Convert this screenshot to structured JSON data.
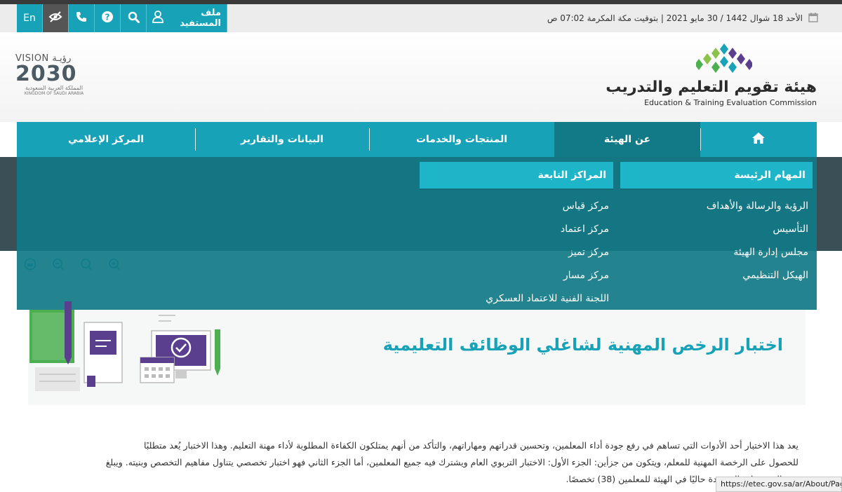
{
  "utility_bar": {
    "lang_label": "En",
    "beneficiary_label": "ملف المستفيد",
    "icons": [
      "eye-slash-icon",
      "phone-icon",
      "help-icon",
      "search-icon",
      "user-icon"
    ]
  },
  "date_text": "الأحد 18 شوال 1442 / 30 مايو 2021 | بتوقيت مكة المكرمة 07:02 ص",
  "vision_logo": {
    "line1": "VISION رؤيـة",
    "line2": "2030",
    "line3": "المملكة العربية السعودية",
    "line4": "KINGDOM OF SAUDI ARABIA"
  },
  "org_logo": {
    "name_ar": "هيئة تقويم التعليم والتدريب",
    "name_en": "Education & Training Evaluation Commission"
  },
  "nav": {
    "items": [
      {
        "label": "عن الهيئة"
      },
      {
        "label": "المنتجات والخدمات"
      },
      {
        "label": "البيانات والتقارير"
      },
      {
        "label": "المركز الإعلامي"
      }
    ]
  },
  "mega_menu": {
    "columns": [
      {
        "heading": "المهام الرئيسة",
        "items": [
          "الرؤية والرسالة والأهداف",
          "التأسيس",
          "مجلس إدارة الهيئة",
          "الهيكل التنظيمي"
        ]
      },
      {
        "heading": "المراكز التابعة",
        "items": [
          "مركز قياس",
          "مركز اعتماد",
          "مركز تميز",
          "مركز مسار",
          "اللجنة الفنية للاعتماد العسكري"
        ]
      }
    ]
  },
  "page": {
    "title": "اختبار الرخص المهنية لشاغلي الوظائف التعليمية",
    "paragraph_lines": [
      "يعد هذا الاختبار أحد الأدوات التي تساهم في رفع جودة أداء المعلمين، وتحسين قدراتهم ومهاراتهم، والتأكد من أنهم يمتلكون الكفاءة المطلوبة لأداء مهنة التعليم. وهذا الاختبار يُعد متطلبًا",
      "للحصول على الرخصة المهنية للمعلم، ويتكون من جزأين: الجزء الأول: الاختبار التربوي العام ويشترك فيه جميع المعلمين، أما الجزء الثاني فهو اختبار تخصصي يتناول مفاهيم التخصص وبنيته. ويبلغ",
      "عدد التخصصات المعتمدة حاليًا في الهيئة للمعلمين (38) تخصصًا."
    ]
  },
  "status_url": "https://etec.gov.sa/ar/About/Pag",
  "colors": {
    "primary": "#17a2b8",
    "primary_dark": "#127a87",
    "band": "#3b4f57"
  }
}
